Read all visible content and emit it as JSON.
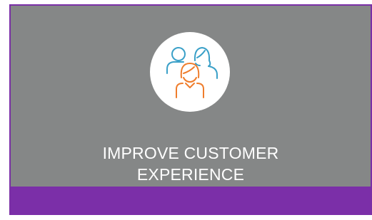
{
  "card": {
    "title_line_1": "IMPROVE CUSTOMER",
    "title_line_2": "EXPERIENCE",
    "icon": "customer-group-icon"
  },
  "colors": {
    "card_background": "#858787",
    "accent_purple": "#7b2fa8",
    "icon_blue": "#3aa0c8",
    "icon_orange": "#ef7d2c",
    "text": "#ffffff"
  }
}
